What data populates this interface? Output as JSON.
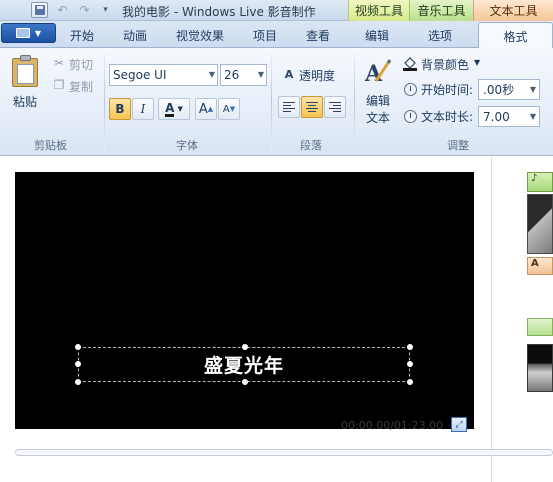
{
  "titlebar": {
    "app_title": "我的电影 - Windows Live 影音制作",
    "contextual_tabs": [
      "视频工具",
      "音乐工具",
      "文本工具"
    ]
  },
  "tabs": [
    "开始",
    "动画",
    "视觉效果",
    "项目",
    "查看",
    "编辑",
    "选项",
    "格式"
  ],
  "active_tab": "格式",
  "ribbon": {
    "clipboard": {
      "paste": "粘贴",
      "cut": "剪切",
      "copy": "复制",
      "group": "剪贴板"
    },
    "font": {
      "family": "Segoe UI",
      "size": "26",
      "bold": "B",
      "italic": "I",
      "color": "A",
      "grow": "A",
      "shrink": "A",
      "group": "字体"
    },
    "paragraph": {
      "transparency": "透明度",
      "group": "段落"
    },
    "adjust": {
      "edit_text_line1": "编辑",
      "edit_text_line2": "文本",
      "background_color": "背景颜色",
      "start_time_label": "开始时间:",
      "start_time_value": ".00秒",
      "duration_label": "文本时长:",
      "duration_value": "7.00",
      "group": "调整"
    }
  },
  "preview": {
    "caption": "盛夏光年",
    "timecode": "00:00.00/01:23.00"
  },
  "storyboard": {
    "music_tag": "♪",
    "text_tag": "A"
  }
}
